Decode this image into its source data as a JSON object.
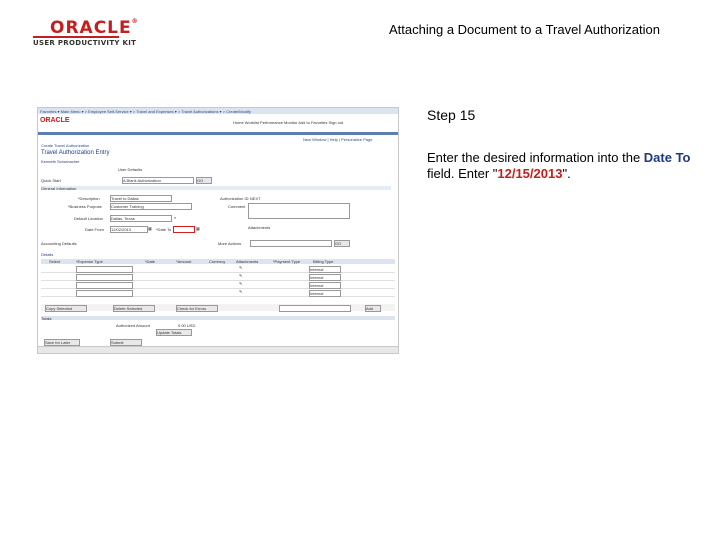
{
  "header": {
    "logo_text": "ORACLE",
    "logo_subtext": "USER PRODUCTIVITY KIT",
    "doc_title": "Attaching a Document to a Travel Authorization"
  },
  "step": {
    "label": "Step 15",
    "instruction_prefix": "Enter the desired information into the ",
    "field_name": "Date To",
    "instruction_middle": " field. Enter \"",
    "value": "12/15/2013",
    "instruction_suffix": "\"."
  },
  "screenshot": {
    "breadcrumb": "Favorites ▾   Main Menu ▾  > Employee Self-Service ▾ > Travel and Expenses ▾ > Travel Authorizations ▾ > Create/Modify",
    "brand": "ORACLE",
    "nav_links": "Home   Worklist   Performance Monitor   Add to Favorites   Sign out",
    "page_links": "New Window | Help | Personalize Page",
    "crumb": "Create Travel Authorization",
    "page_title": "Travel Authorization Entry",
    "employee_name": "Kenneth Schumacher",
    "user_defaults": "User Defaults",
    "quick_start_label": "Quick Start",
    "quick_start_value": "A Blank Authorization",
    "go": "GO",
    "section_general": "General Information",
    "description_label": "*Description",
    "description_value": "Travel to Dallas",
    "business_purpose_label": "*Business Purpose",
    "business_purpose_value": "Customer Training",
    "default_location_label": "Default Location",
    "default_location_value": "Dallas, Texas",
    "date_from_label": "Date From",
    "date_from_value": "12/02/2013",
    "date_to_label": "*Date To",
    "auth_id_label": "Authorization ID",
    "auth_id_value": "NEXT",
    "comment_label": "Comment",
    "attachments": "Attachments",
    "accounting_defaults": "Accounting Defaults",
    "more_actions": "More Actions",
    "details": "Details",
    "columns": [
      "Select",
      "*Expense Type",
      "*Date",
      "*Amount",
      "Currency",
      "Attachments",
      "*Payment Type",
      "Billing Type"
    ],
    "rows": [
      {
        "billing": "Internal"
      },
      {
        "billing": "Internal"
      },
      {
        "billing": "Internal"
      },
      {
        "billing": "Internal"
      }
    ],
    "btn_copy": "Copy Selected",
    "btn_delete": "Delete Selected",
    "btn_check": "Check for Errors",
    "btn_add": "Add",
    "totals": "Totals",
    "authorized_amount_label": "Authorized Amount",
    "authorized_amount_value": "0.00 USD",
    "update_totals": "Update Totals",
    "btn_save_later": "Save for Later",
    "btn_submit": "Submit"
  }
}
